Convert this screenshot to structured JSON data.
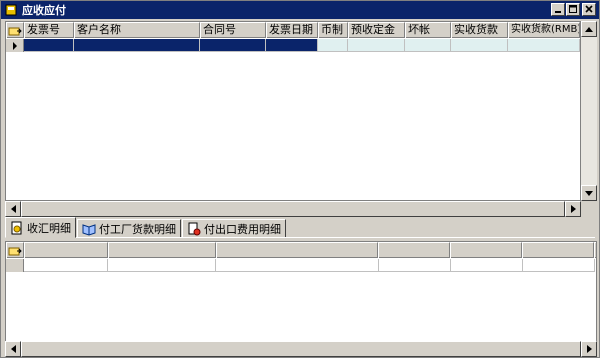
{
  "window": {
    "title": "应收应付"
  },
  "main_grid": {
    "columns": [
      "发票号",
      "客户名称",
      "合同号",
      "发票日期",
      "币制",
      "预收定金",
      "坏帐",
      "实收货款",
      "实收货款(RMB)"
    ]
  },
  "tabs": [
    {
      "label": "收汇明细",
      "active": true
    },
    {
      "label": "付工厂货款明细",
      "active": false
    },
    {
      "label": "付出口费用明细",
      "active": false
    }
  ],
  "detail_grid": {
    "columns": [
      "",
      "",
      "",
      "",
      "",
      "",
      ""
    ]
  },
  "colors": {
    "titlebar": "#0a246a",
    "selected_row": "#0a246a",
    "row_light": "#e0f0f0"
  }
}
